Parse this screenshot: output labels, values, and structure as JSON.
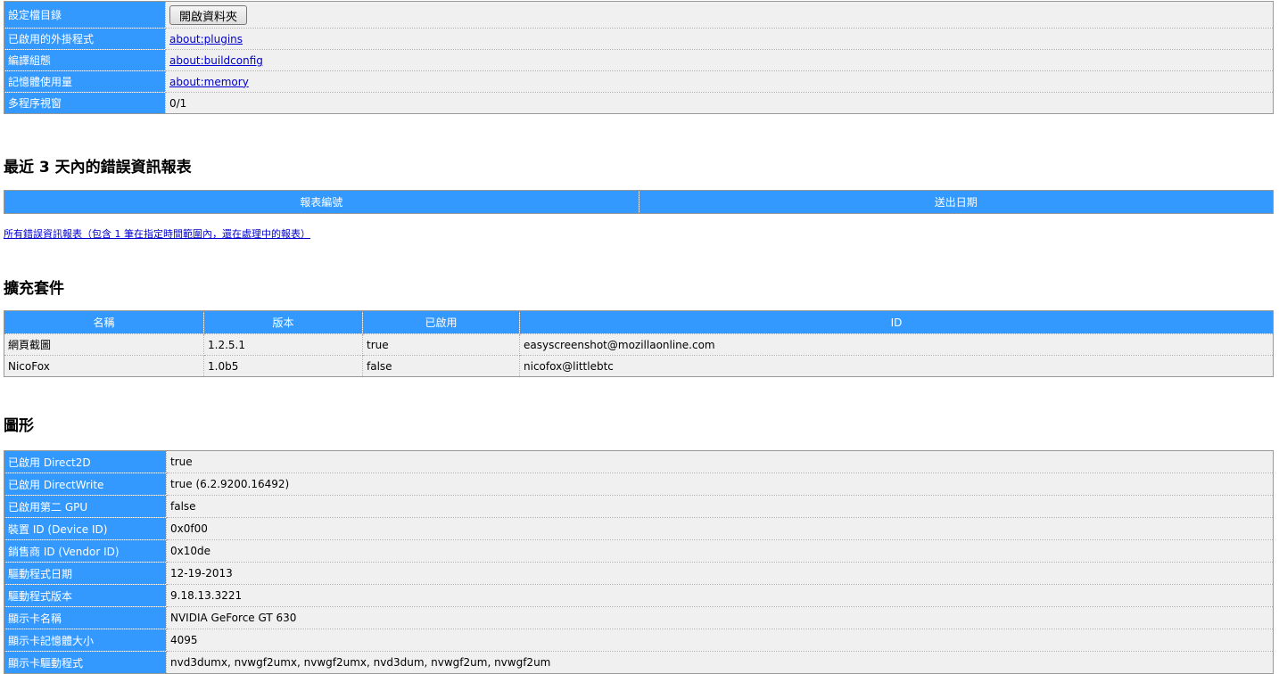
{
  "app_info": {
    "rows": [
      {
        "label": "設定檔目錄",
        "button": "開啟資料夾"
      },
      {
        "label": "已啟用的外掛程式",
        "link": "about:plugins"
      },
      {
        "label": "編譯組態",
        "link": "about:buildconfig"
      },
      {
        "label": "記憶體使用量",
        "link": "about:memory"
      },
      {
        "label": "多程序視窗",
        "value": "0/1"
      }
    ]
  },
  "crash": {
    "title": "最近 3 天內的錯誤資訊報表",
    "headers": [
      "報表編號",
      "送出日期"
    ],
    "all_link": "所有錯誤資訊報表（包含 1 筆在指定時間範圍內，還在處理中的報表）"
  },
  "extensions": {
    "title": "擴充套件",
    "headers": [
      "名稱",
      "版本",
      "已啟用",
      "ID"
    ],
    "rows": [
      [
        "網頁截圖",
        "1.2.5.1",
        "true",
        "easyscreenshot@mozillaonline.com"
      ],
      [
        "NicoFox",
        "1.0b5",
        "false",
        "nicofox@littlebtc"
      ]
    ]
  },
  "graphics": {
    "title": "圖形",
    "rows": [
      {
        "label": "已啟用 Direct2D",
        "value": "true"
      },
      {
        "label": "已啟用 DirectWrite",
        "value": "true (6.2.9200.16492)"
      },
      {
        "label": "已啟用第二 GPU",
        "value": "false"
      },
      {
        "label": "裝置 ID (Device ID)",
        "value": "0x0f00"
      },
      {
        "label": "銷售商 ID (Vendor ID)",
        "value": "0x10de"
      },
      {
        "label": "驅動程式日期",
        "value": "12-19-2013"
      },
      {
        "label": "驅動程式版本",
        "value": "9.18.13.3221"
      },
      {
        "label": "顯示卡名稱",
        "value": "NVIDIA GeForce GT 630"
      },
      {
        "label": "顯示卡記憶體大小",
        "value": "4095"
      },
      {
        "label": "顯示卡驅動程式",
        "value": "nvd3dumx, nvwgf2umx, nvwgf2umx, nvd3dum, nvwgf2um, nvwgf2um"
      }
    ]
  }
}
